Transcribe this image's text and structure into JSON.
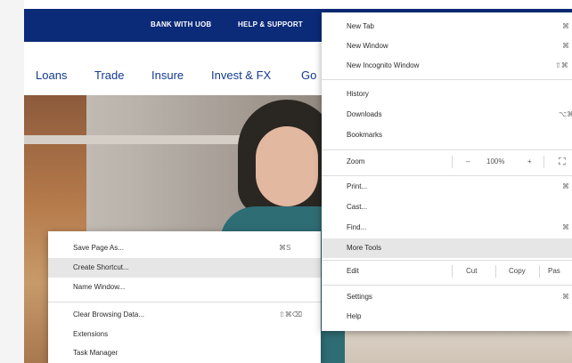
{
  "site": {
    "topbar": {
      "bank_with_uob": "BANK WITH UOB",
      "help_support": "HELP & SUPPORT"
    },
    "nav": [
      "Loans",
      "Trade",
      "Insure",
      "Invest & FX",
      "Go"
    ]
  },
  "main_menu": {
    "new_tab": {
      "label": "New Tab",
      "shortcut": "⌘"
    },
    "new_window": {
      "label": "New Window",
      "shortcut": "⌘"
    },
    "new_incognito": {
      "label": "New Incognito Window",
      "shortcut": "⇧⌘"
    },
    "history": {
      "label": "History"
    },
    "downloads": {
      "label": "Downloads",
      "shortcut": "⌥⌘"
    },
    "bookmarks": {
      "label": "Bookmarks"
    },
    "zoom": {
      "label": "Zoom",
      "minus": "–",
      "level": "100%",
      "plus": "+",
      "fullscreen": "⛶"
    },
    "print": {
      "label": "Print...",
      "shortcut": "⌘"
    },
    "cast": {
      "label": "Cast..."
    },
    "find": {
      "label": "Find...",
      "shortcut": "⌘"
    },
    "more_tools": {
      "label": "More Tools"
    },
    "edit": {
      "label": "Edit",
      "cut": "Cut",
      "copy": "Copy",
      "paste": "Pas"
    },
    "settings": {
      "label": "Settings",
      "shortcut": "⌘"
    },
    "help": {
      "label": "Help"
    }
  },
  "sub_menu": {
    "save_page_as": {
      "label": "Save Page As...",
      "shortcut": "⌘S"
    },
    "create_shortcut": {
      "label": "Create Shortcut..."
    },
    "name_window": {
      "label": "Name Window..."
    },
    "clear_browsing_data": {
      "label": "Clear Browsing Data...",
      "shortcut": "⇧⌘⌫"
    },
    "extensions": {
      "label": "Extensions"
    },
    "task_manager": {
      "label": "Task Manager"
    }
  },
  "colors": {
    "topbar": "#0b2a78",
    "nav_text": "#123a8f",
    "menu_highlight": "#e6e6e6"
  }
}
